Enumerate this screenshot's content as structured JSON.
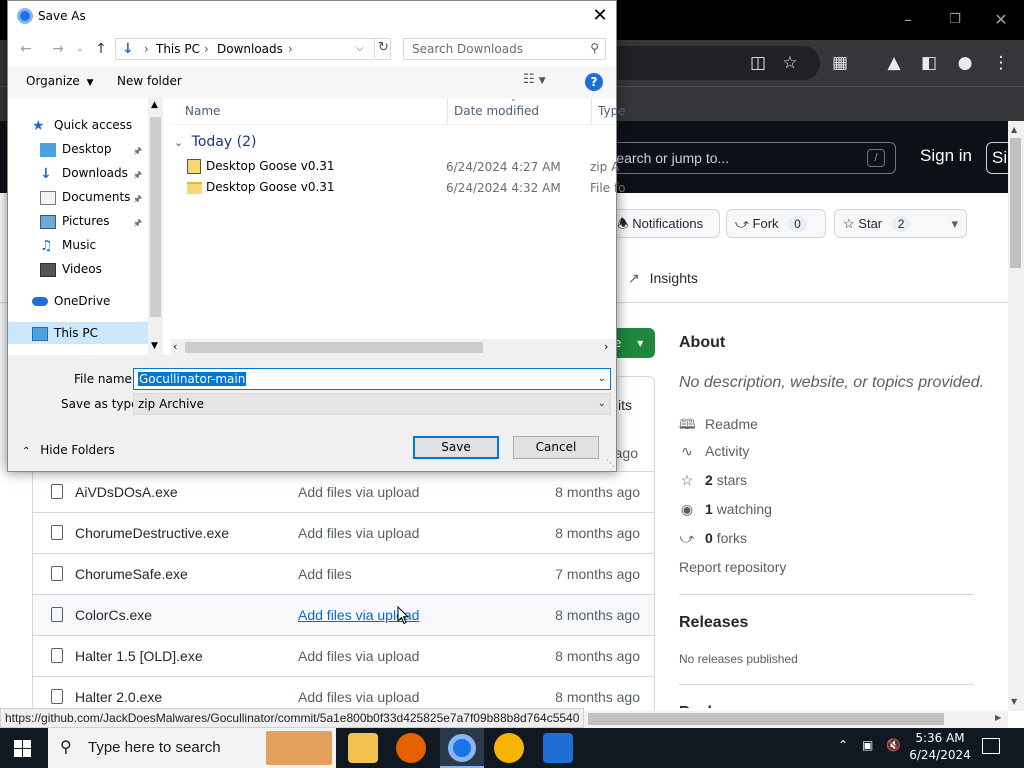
{
  "github": {
    "search_placeholder": "Search or jump to...",
    "search_hotkey": "/",
    "signin": "Sign in",
    "signup": "Si",
    "notifications": "Notifications",
    "fork_label": "Fork",
    "fork_count": "0",
    "star_label": "Star",
    "star_count": "2",
    "insights": "Insights",
    "code_fragment": "e",
    "commits_fragment": "its",
    "ago_fragment": "ago",
    "files": [
      {
        "name": "AiVDsDOsA.exe",
        "message": "Add files via upload",
        "date": "8 months ago",
        "link": false
      },
      {
        "name": "ChorumeDestructive.exe",
        "message": "Add files via upload",
        "date": "8 months ago",
        "link": false
      },
      {
        "name": "ChorumeSafe.exe",
        "message": "Add files",
        "date": "7 months ago",
        "link": false
      },
      {
        "name": "ColorCs.exe",
        "message": "Add files via upload",
        "date": "8 months ago",
        "link": true
      },
      {
        "name": "Halter 1.5 [OLD].exe",
        "message": "Add files via upload",
        "date": "8 months ago",
        "link": false
      },
      {
        "name": "Halter 2.0.exe",
        "message": "Add files via upload",
        "date": "8 months ago",
        "link": false
      }
    ],
    "about": {
      "title": "About",
      "description": "No description, website, or topics provided.",
      "readme": "Readme",
      "activity": "Activity",
      "stars_count": "2",
      "stars_label": "stars",
      "watching_count": "1",
      "watching_label": "watching",
      "forks_count": "0",
      "forks_label": "forks",
      "report": "Report repository",
      "releases_title": "Releases",
      "releases_desc": "No releases published",
      "packages_fragment": "Packages"
    },
    "status_url": "https://github.com/JackDoesMalwares/Gocullinator/commit/5a1e800b0f33d425825e7a7f09b88b8d764c5540"
  },
  "dialog": {
    "title": "Save As",
    "breadcrumb": [
      "This PC",
      "Downloads"
    ],
    "search_placeholder": "Search Downloads",
    "organize": "Organize",
    "new_folder": "New folder",
    "sidebar": [
      {
        "label": "Quick access",
        "icon": "star-icon"
      },
      {
        "label": "Desktop",
        "icon": "desktop-folder-icon"
      },
      {
        "label": "Downloads",
        "icon": "downloads-folder-icon"
      },
      {
        "label": "Documents",
        "icon": "documents-folder-icon"
      },
      {
        "label": "Pictures",
        "icon": "pictures-folder-icon"
      },
      {
        "label": "Music",
        "icon": "music-folder-icon"
      },
      {
        "label": "Videos",
        "icon": "videos-folder-icon"
      },
      {
        "label": "OneDrive",
        "icon": "onedrive-icon"
      },
      {
        "label": "This PC",
        "icon": "this-pc-icon"
      }
    ],
    "columns": {
      "name": "Name",
      "date": "Date modified",
      "type": "Type"
    },
    "group": "Today (2)",
    "files": [
      {
        "name": "Desktop Goose v0.31",
        "date": "6/24/2024 4:27 AM",
        "type": "zip A",
        "icon": "zip-file-icon"
      },
      {
        "name": "Desktop Goose v0.31",
        "date": "6/24/2024 4:32 AM",
        "type": "File fo",
        "icon": "folder-icon"
      }
    ],
    "file_name_label": "File name:",
    "file_name_value": "Gocullinator-main",
    "save_type_label": "Save as type:",
    "save_type_value": "zip Archive",
    "hide_folders": "Hide Folders",
    "save": "Save",
    "cancel": "Cancel"
  },
  "taskbar": {
    "search_placeholder": "Type here to search",
    "time": "5:36 AM",
    "date": "6/24/2024"
  }
}
